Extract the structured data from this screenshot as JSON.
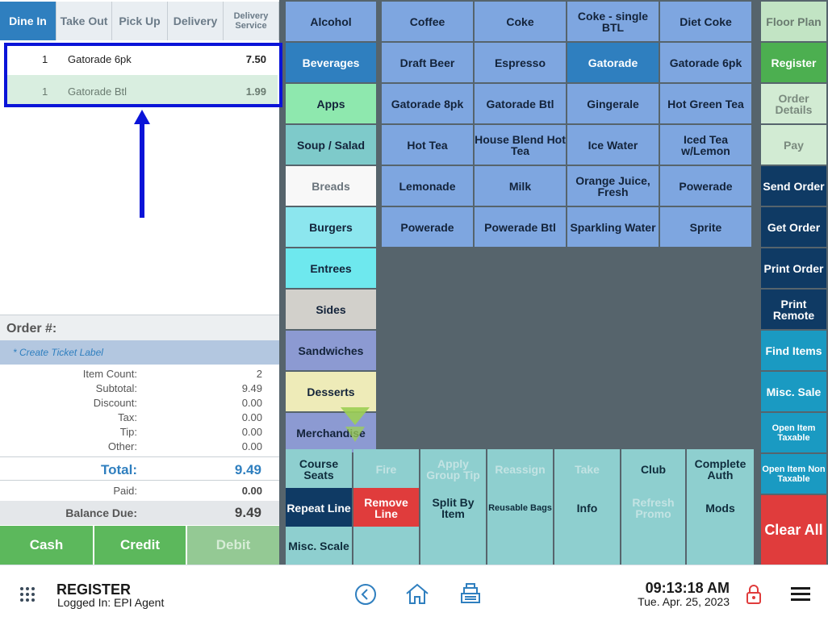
{
  "tabs": [
    "Dine In",
    "Take Out",
    "Pick Up",
    "Delivery",
    "Delivery Service"
  ],
  "order_lines": [
    {
      "qty": "1",
      "name": "Gatorade 6pk",
      "price": "7.50"
    },
    {
      "qty": "1",
      "name": "Gatorade Btl",
      "price": "1.99"
    }
  ],
  "order_number_label": "Order #:",
  "ticket_label": "* Create Ticket Label",
  "summary": [
    {
      "label": "Item Count:",
      "value": "2"
    },
    {
      "label": "Subtotal:",
      "value": "9.49"
    },
    {
      "label": "Discount:",
      "value": "0.00"
    },
    {
      "label": "Tax:",
      "value": "0.00"
    },
    {
      "label": "Tip:",
      "value": "0.00"
    },
    {
      "label": "Other:",
      "value": "0.00"
    }
  ],
  "total_label": "Total:",
  "total_value": "9.49",
  "paid_label": "Paid:",
  "paid_value": "0.00",
  "balance_label": "Balance Due:",
  "balance_value": "9.49",
  "pay_buttons": [
    "Cash",
    "Credit",
    "Debit"
  ],
  "categories": [
    "Alcohol",
    "Beverages",
    "Apps",
    "Soup / Salad",
    "Breads",
    "Burgers",
    "Entrees",
    "Sides",
    "Sandwiches",
    "Desserts",
    "Merchandise"
  ],
  "items": [
    "Coffee",
    "Coke",
    "Coke - single BTL",
    "Diet Coke",
    "Draft Beer",
    "Espresso",
    "Gatorade",
    "Gatorade 6pk",
    "Gatorade 8pk",
    "Gatorade Btl",
    "Gingerale",
    "Hot Green Tea",
    "Hot Tea",
    "House Blend Hot Tea",
    "Ice Water",
    "Iced Tea w/Lemon",
    "Lemonade",
    "Milk",
    "Orange Juice, Fresh",
    "Powerade",
    "Powerade",
    "Powerade Btl",
    "Sparkling Water",
    "Sprite"
  ],
  "actions_row1": [
    "Course Seats",
    "Fire",
    "Apply Group Tip",
    "Reassign",
    "Take",
    "Club",
    "Complete Auth"
  ],
  "actions_row2": [
    "Repeat Line",
    "Remove Line",
    "Split By Item",
    "Reusable Bags",
    "Info",
    "Refresh Promo",
    "Mods"
  ],
  "actions_row3": [
    "Misc. Scale"
  ],
  "side_buttons": [
    "Floor Plan",
    "Register",
    "Order Details",
    "Pay",
    "Send Order",
    "Get Order",
    "Print Order",
    "Print Remote",
    "Find Items",
    "Misc. Sale",
    "Open Item Taxable",
    "Open Item Non Taxable",
    "Clear All"
  ],
  "footer": {
    "title": "REGISTER",
    "logged_in": "Logged In:  EPI Agent",
    "time": "09:13:18 AM",
    "date": "Tue. Apr. 25, 2023"
  },
  "colors": {
    "accent": "#2f7fbf",
    "highlight_box": "#0a14d8",
    "register": "#4caf50",
    "clear": "#e03c3c"
  }
}
